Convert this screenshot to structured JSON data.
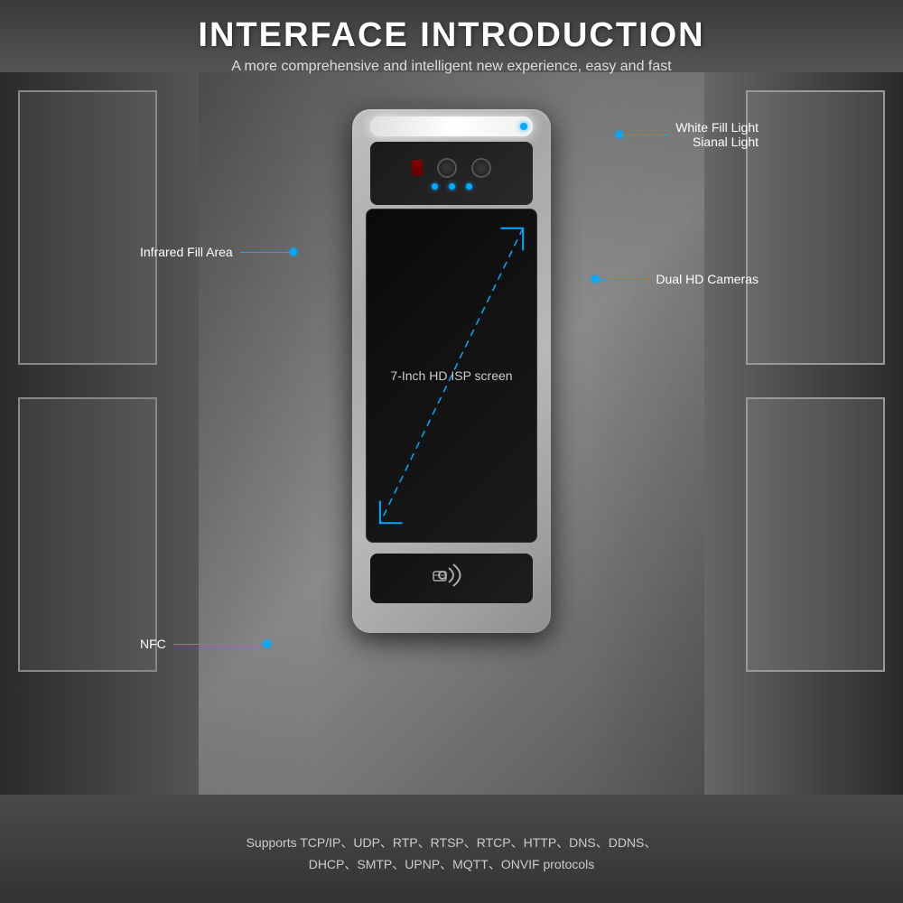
{
  "page": {
    "title": "INTERFACE INTRODUCTION",
    "subtitle": "A more comprehensive and intelligent new experience, easy and fast",
    "footer_line1": "Supports TCP/IP、UDP、RTP、RTSP、RTCP、HTTP、DNS、DDNS、",
    "footer_line2": "DHCP、SMTP、UPNP、MQTT、ONVIF protocols"
  },
  "annotations": {
    "white_fill_light_line1": "White Fill Light",
    "white_fill_light_line2": "Sianal Light",
    "infrared_fill_area": "Infrared Fill Area",
    "dual_hd_cameras": "Dual HD Cameras",
    "screen_label": "7-Inch HD ISP screen",
    "nfc_label": "NFC"
  },
  "colors": {
    "accent_blue": "#00aaff",
    "text_white": "#ffffff",
    "text_light": "#dddddd",
    "bg_dark": "#3a3a3a"
  }
}
